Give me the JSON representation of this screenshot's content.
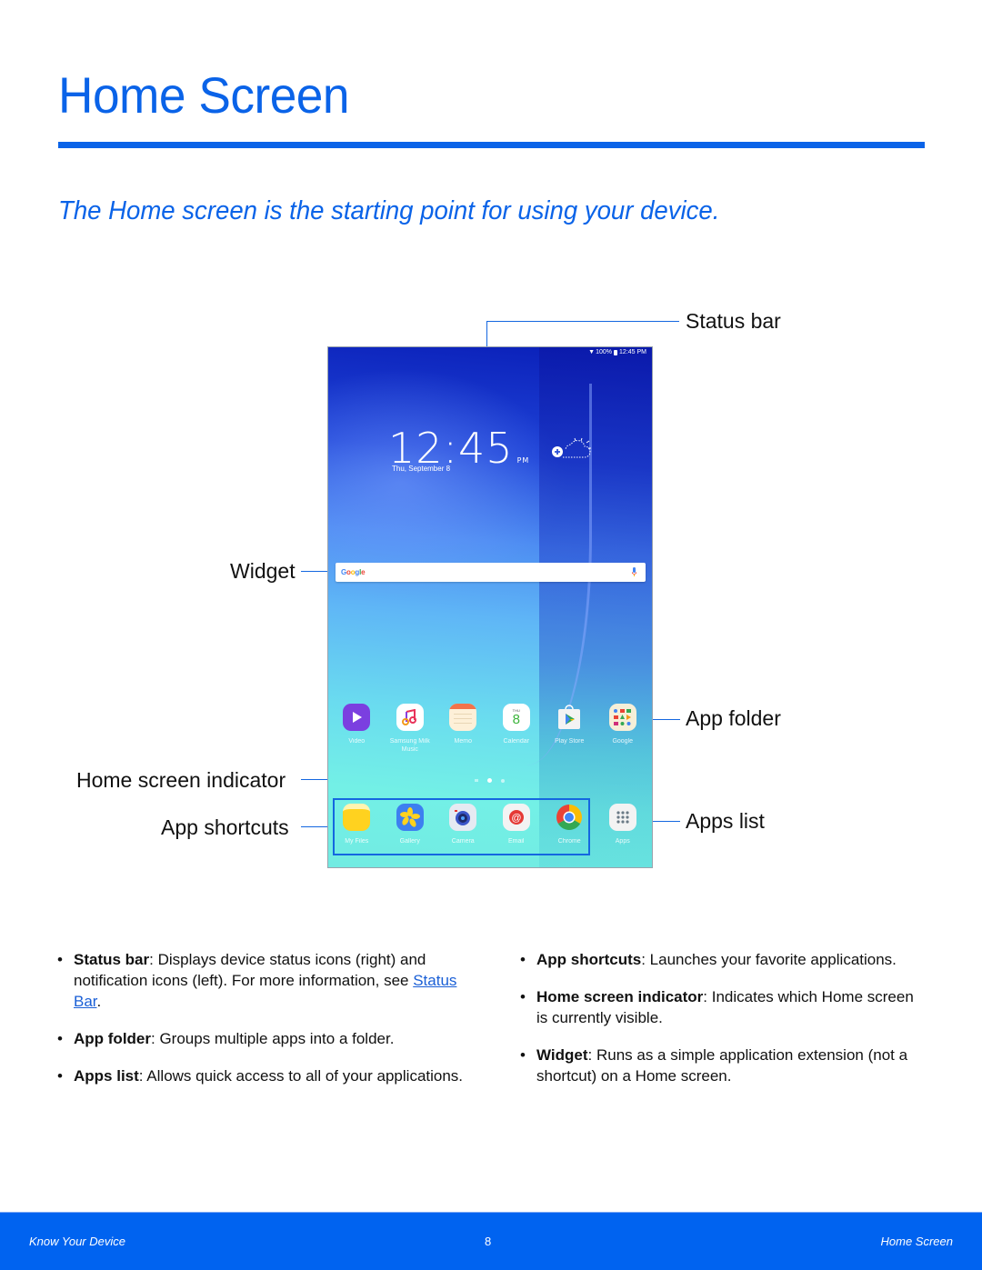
{
  "page": {
    "title": "Home Screen",
    "subtitle": "The Home screen is the starting point for using your device.",
    "accent_color": "#0a63e8"
  },
  "callouts": {
    "status_bar": "Status bar",
    "widget": "Widget",
    "app_folder": "App folder",
    "home_screen_indicator": "Home screen indicator",
    "app_shortcuts": "App shortcuts",
    "apps_list": "Apps list"
  },
  "device": {
    "status": {
      "signal_icon": "wifi-icon",
      "battery": "100%",
      "battery_icon": "battery-icon",
      "time": "12:45 PM"
    },
    "clock": {
      "time": "12:45",
      "ampm": "PM",
      "date": "Thu, September 8"
    },
    "weather_icon": "add-weather-icon",
    "search": {
      "logo": "Google",
      "mic_icon": "mic-icon"
    },
    "apps": [
      {
        "label": "Video",
        "icon": "video-icon"
      },
      {
        "label": "Samsung Milk Music",
        "icon": "milk-music-icon"
      },
      {
        "label": "Memo",
        "icon": "memo-icon"
      },
      {
        "label": "Calendar",
        "icon": "calendar-icon",
        "day": "THU",
        "date": "8"
      },
      {
        "label": "Play Store",
        "icon": "play-store-icon"
      },
      {
        "label": "Google",
        "icon": "google-folder-icon"
      }
    ],
    "home_pages": {
      "count": 3,
      "active_index": 1
    },
    "dock": [
      {
        "label": "My Files",
        "icon": "my-files-icon"
      },
      {
        "label": "Gallery",
        "icon": "gallery-icon"
      },
      {
        "label": "Camera",
        "icon": "camera-icon"
      },
      {
        "label": "Email",
        "icon": "email-icon"
      },
      {
        "label": "Chrome",
        "icon": "chrome-icon"
      },
      {
        "label": "Apps",
        "icon": "apps-grid-icon"
      }
    ]
  },
  "bullets_left": [
    {
      "term": "Status bar",
      "text": ": Displays device status icons (right) and notification icons (left). For more information, see ",
      "link": "Status Bar",
      "after": "."
    },
    {
      "term": "App folder",
      "text": ": Groups multiple apps into a folder."
    },
    {
      "term": "Apps list",
      "text": ": Allows quick access to all of your applications."
    }
  ],
  "bullets_right": [
    {
      "term": "App shortcuts",
      "text": ": Launches your favorite applications."
    },
    {
      "term": "Home screen indicator",
      "text": ": Indicates which Home screen is currently visible."
    },
    {
      "term": "Widget",
      "text": ": Runs as a simple application extension (not a shortcut) on a Home screen."
    }
  ],
  "footer": {
    "section": "Know Your Device",
    "page_number": "8",
    "topic": "Home Screen",
    "color": "#0063f0"
  }
}
